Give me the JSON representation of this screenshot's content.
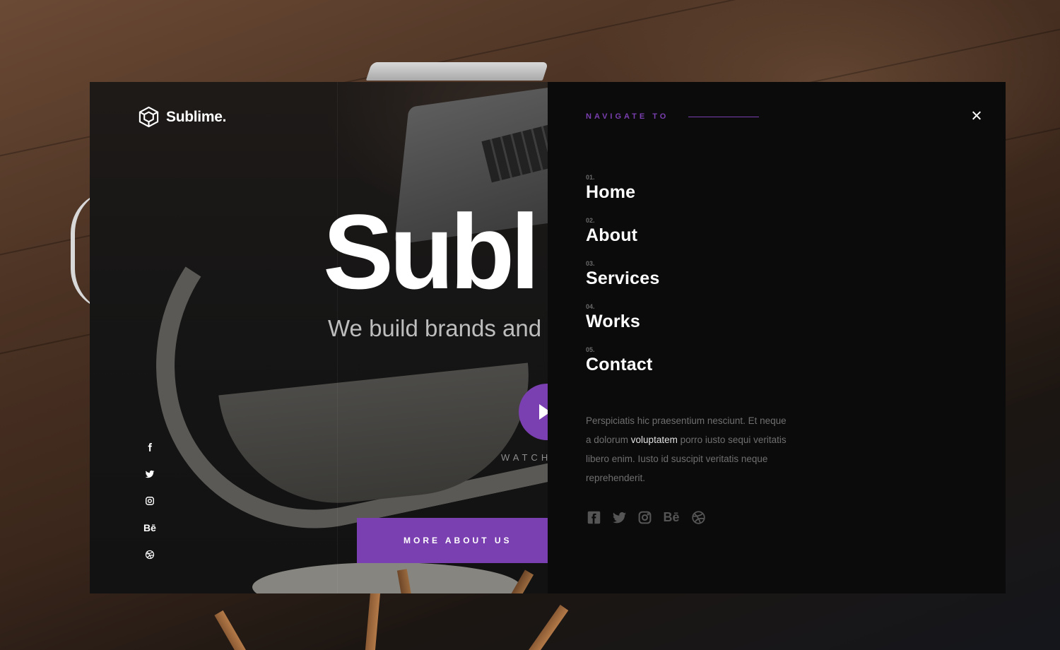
{
  "brand": {
    "name": "Sublime."
  },
  "hero": {
    "title": "Subl",
    "subtitle": "We build brands and",
    "watch_label": "WATCH",
    "cta_label": "MORE ABOUT US"
  },
  "social_left": [
    {
      "icon": "facebook-icon"
    },
    {
      "icon": "twitter-icon"
    },
    {
      "icon": "instagram-icon"
    },
    {
      "icon": "behance-icon",
      "glyph": "Bē"
    },
    {
      "icon": "dribbble-icon"
    }
  ],
  "nav": {
    "heading": "NAVIGATE TO",
    "items": [
      {
        "num": "01.",
        "label": "Home"
      },
      {
        "num": "02.",
        "label": "About"
      },
      {
        "num": "03.",
        "label": "Services"
      },
      {
        "num": "04.",
        "label": "Works"
      },
      {
        "num": "05.",
        "label": "Contact"
      }
    ],
    "desc_before": "Perspiciatis hic praesentium nesciunt. Et neque a dolorum ",
    "desc_highlight": "voluptatem",
    "desc_after": " porro iusto sequi veritatis libero enim. Iusto id suscipit veritatis neque reprehenderit.",
    "social": [
      {
        "icon": "facebook-icon"
      },
      {
        "icon": "twitter-icon"
      },
      {
        "icon": "instagram-icon"
      },
      {
        "icon": "behance-icon",
        "glyph": "Bē"
      },
      {
        "icon": "dribbble-icon"
      }
    ]
  },
  "colors": {
    "accent": "#7a3fb0",
    "panel": "#0c0b0c",
    "text": "#ffffff"
  }
}
